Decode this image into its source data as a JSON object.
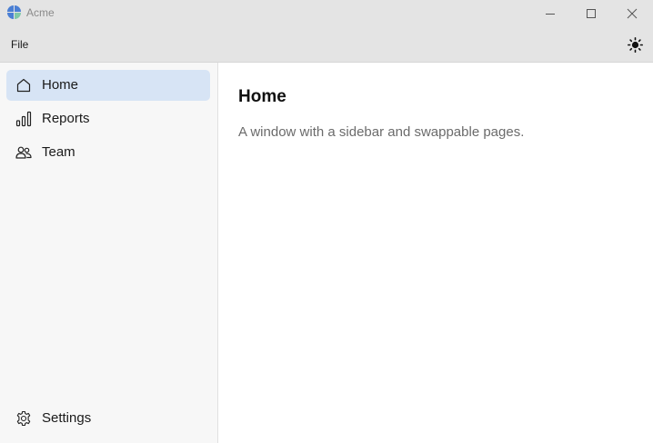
{
  "window": {
    "title": "Acme",
    "buttons": {
      "minimize": "minimize-icon",
      "maximize": "maximize-icon",
      "close": "close-icon"
    }
  },
  "menubar": {
    "file_label": "File",
    "theme_icon": "sun-icon"
  },
  "sidebar": {
    "items": [
      {
        "label": "Home",
        "icon": "home-icon",
        "active": true
      },
      {
        "label": "Reports",
        "icon": "bar-chart-icon",
        "active": false
      },
      {
        "label": "Team",
        "icon": "people-icon",
        "active": false
      }
    ],
    "footer": {
      "label": "Settings",
      "icon": "gear-icon"
    }
  },
  "main": {
    "title": "Home",
    "description": "A window with a sidebar and swappable pages."
  },
  "colors": {
    "chrome": "#e4e4e4",
    "sidebar_bg": "#f7f7f7",
    "active_item": "#d7e4f5",
    "logo": "#4a7fd4"
  }
}
